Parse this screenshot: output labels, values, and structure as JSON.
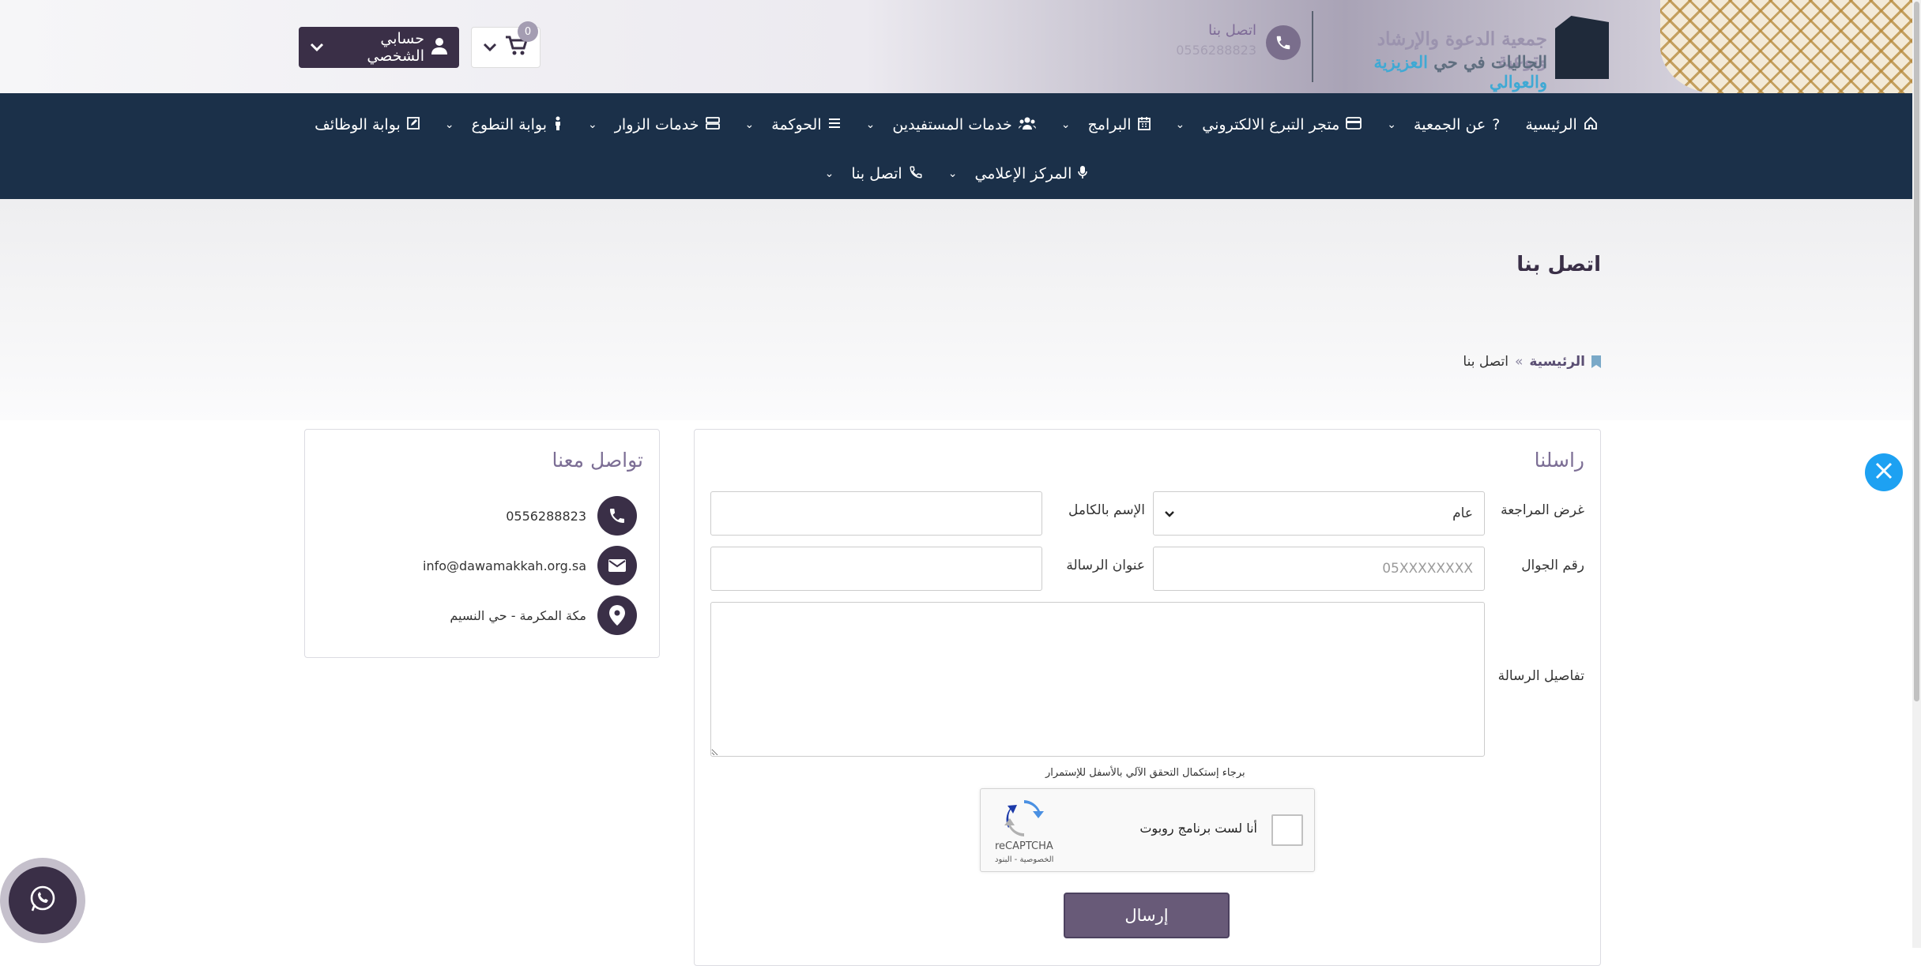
{
  "header": {
    "logo_line1": "جمعية الدعوة والإرشاد وتوعية",
    "logo_line2_part1": "الجاليات في حي ",
    "logo_line2_accent": "العزيزية والعوالي",
    "contact_label": "اتصل بنا",
    "contact_number": "0556288823",
    "account_label": "حسابي الشخصي",
    "cart_count": "0"
  },
  "nav": {
    "row1": [
      {
        "label": "الرئيسية",
        "icon": "home-icon"
      },
      {
        "label": "عن الجمعية",
        "icon": "question-icon"
      },
      {
        "label": "متجر التبرع الالكتروني",
        "icon": "card-icon"
      },
      {
        "label": "البرامج",
        "icon": "calendar-icon"
      },
      {
        "label": "خدمات المستفيدين",
        "icon": "users-icon"
      },
      {
        "label": "الحوكمة",
        "icon": "list-icon"
      },
      {
        "label": "خدمات الزوار",
        "icon": "server-icon"
      },
      {
        "label": "بوابة التطوع",
        "icon": "person-icon"
      },
      {
        "label": "بوابة الوظائف",
        "icon": "edit-icon"
      }
    ],
    "row2": [
      {
        "label": "المركز الإعلامي",
        "icon": "mic-icon"
      },
      {
        "label": "اتصل بنا",
        "icon": "phone-icon"
      }
    ]
  },
  "page": {
    "title": "اتصل بنا",
    "breadcrumb_home": "الرئيسية",
    "breadcrumb_sep": "»",
    "breadcrumb_current": "اتصل بنا"
  },
  "form": {
    "title": "راسلنا",
    "purpose_label": "غرض المراجعة",
    "purpose_value": "عام",
    "name_label": "الإسم بالكامل",
    "name_value": "",
    "phone_label": "رقم الجوال",
    "phone_placeholder": "05XXXXXXXX",
    "subject_label": "عنوان الرسالة",
    "subject_value": "",
    "details_label": "تفاصيل الرسالة",
    "details_value": "",
    "captcha_hint": "برجاء إستكمال التحقق الآلي بالأسفل للإستمرار",
    "captcha_text": "أنا لست برنامج روبوت",
    "captcha_brand": "reCAPTCHA",
    "captcha_links": "الخصوصية - البنود",
    "submit_label": "إرسال"
  },
  "contact_card": {
    "title": "تواصل معنا",
    "phone": "0556288823",
    "email": "info@dawamakkah.org.sa",
    "address": "مكة المكرمة - حي النسيم"
  },
  "colors": {
    "nav_bg": "#1b3049",
    "primary": "#3a2f47",
    "button": "#685a78",
    "twitter": "#1da1f2"
  }
}
